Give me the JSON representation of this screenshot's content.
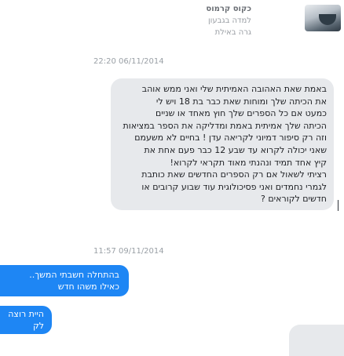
{
  "header": {
    "name": "כקוס קרמוס",
    "subtitle": "למדה בגבעון",
    "location": "גרה באילת"
  },
  "messages": [
    {
      "direction": "incoming",
      "timestamp": "22:20 06/11/2014",
      "lines": [
        "באמת שאת האהובה האמיתית שלי ואני ממש אוהב",
        "את הכיתה שלך ומוחות שאת כבר בת 18 ויש לי",
        "כמעט אם כל הספרים שלך חוץ מאחד או שניים",
        "הכיתה שלך אמיתית באמת ומדליקה את הספר במציאות",
        "וזה רק סיפור דמיוני לקריאה עדן ! בחיים לא משעמם",
        "שאני יכולה לקרוא עד שבע 12 כבר פעם אחת את",
        "קיץ אחד תמיד ונהנתי מאוד תקראי לקרוא!",
        "רציתי לשאול אם רק הספרים החדשים שאת כותבת",
        "לגמרי נחמדים ואני פסיכולוגית עוד שבוע קרובים או",
        "חדשים לקוראים ?"
      ]
    },
    {
      "direction": "outgoing",
      "timestamp": "11:57 09/11/2014",
      "lines": [
        "בהתחלה חשבתי המשך..",
        "כאילו משהו חדש"
      ]
    },
    {
      "direction": "outgoing",
      "lines": [
        "היית רוצה לק"
      ]
    }
  ]
}
